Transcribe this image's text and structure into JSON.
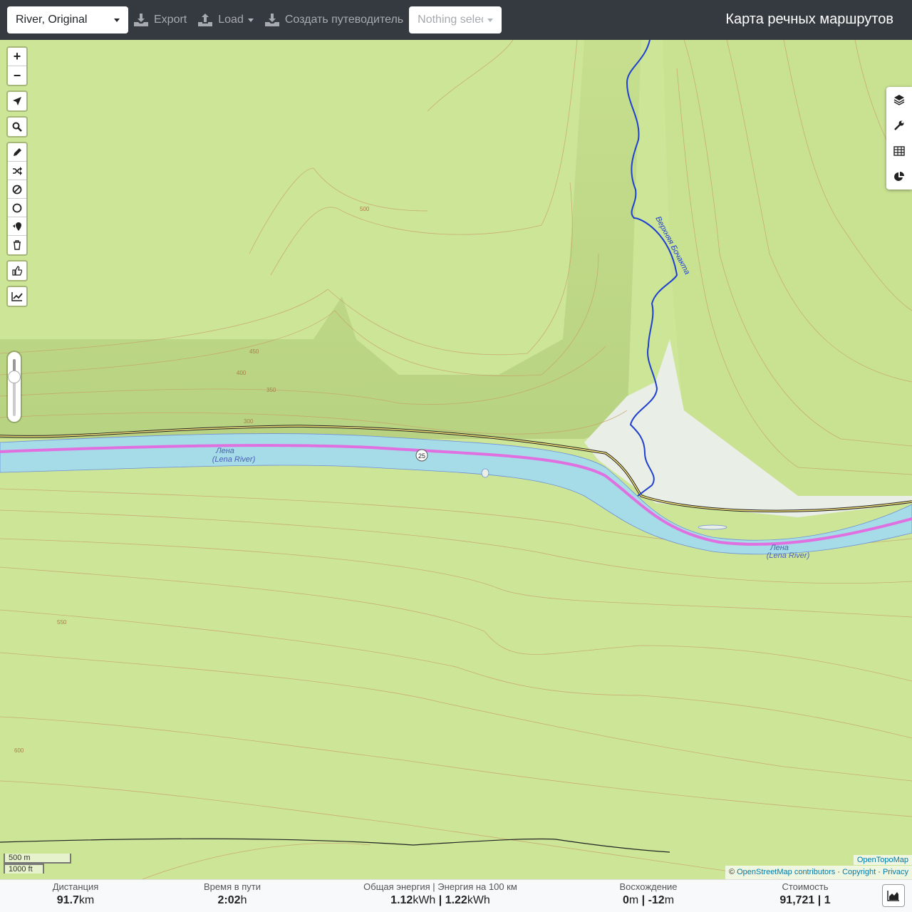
{
  "header": {
    "profile": "River, Original",
    "export_label": "Export",
    "load_label": "Load",
    "guide_label": "Создать путеводитель",
    "selection_placeholder": "Nothing selected",
    "app_title": "Карта речных маршрутов"
  },
  "map": {
    "zoom_in": "+",
    "zoom_out": "−",
    "river_label_ru": "Лена",
    "river_label_en": "(Lena River)",
    "tributary_label": "Верхняя Бочакта",
    "route_number": "25",
    "contour_labels": [
      "300",
      "350",
      "400",
      "450",
      "500",
      "550",
      "600"
    ],
    "scale_metric": "500 m",
    "scale_imperial": "1000 ft",
    "attribution_provider": "OpenTopoMap",
    "attribution_osm": "OpenStreetMap contributors",
    "attribution_copyright": "Copyright",
    "attribution_privacy": "Privacy",
    "colors": {
      "land": "#cde596",
      "river": "#a6dce8",
      "route": "#e070e0",
      "tributary": "#1f3fd1",
      "contour": "#c49a6a"
    }
  },
  "stats": {
    "distance": {
      "label": "Дистанция",
      "value": "91.7",
      "unit": "km"
    },
    "time": {
      "label": "Время в пути",
      "value": "2:02",
      "unit": "h"
    },
    "energy": {
      "label": "Общая энергия | Энергия на 100 км",
      "value1": "1.12",
      "unit1": "kWh",
      "value2": "1.22",
      "unit2": "kWh"
    },
    "ascent": {
      "label": "Восхождение",
      "value1": "0",
      "unit1": "m",
      "value2": "-12",
      "unit2": "m"
    },
    "cost": {
      "label": "Стоимость",
      "value": "91,721 | 1"
    }
  }
}
